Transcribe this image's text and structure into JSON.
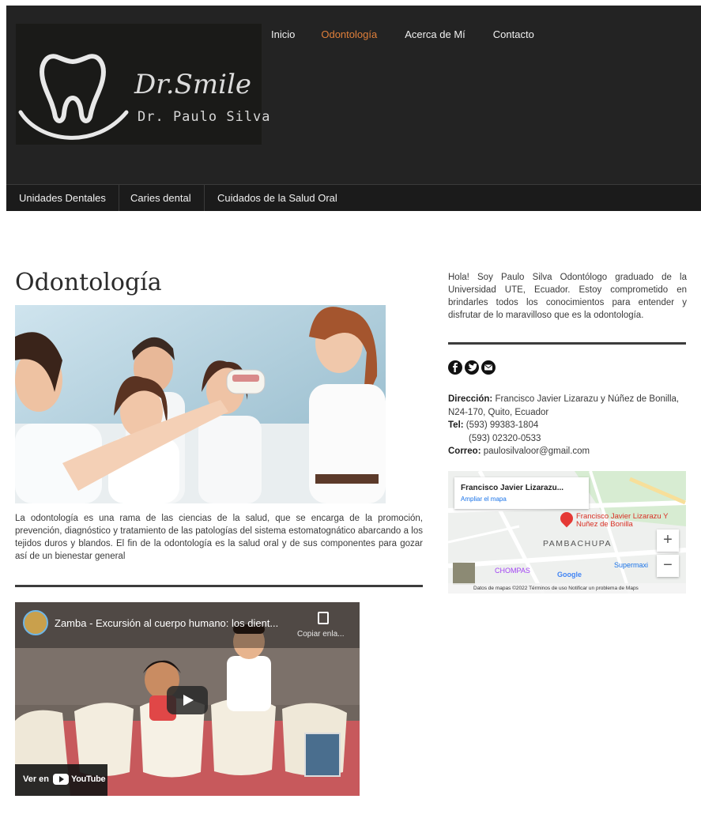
{
  "header": {
    "logo": {
      "script_text": "Dr.Smile",
      "name": "Dr. Paulo Silva"
    },
    "nav": [
      {
        "label": "Inicio",
        "active": false
      },
      {
        "label": "Odontología",
        "active": true
      },
      {
        "label": "Acerca de Mí",
        "active": false
      },
      {
        "label": "Contacto",
        "active": false
      }
    ],
    "subnav": [
      {
        "label": "Unidades Dentales"
      },
      {
        "label": "Caries dental"
      },
      {
        "label": "Cuidados de la Salud Oral"
      }
    ],
    "active_color": "#e07f3a"
  },
  "main": {
    "title": "Odontología",
    "intro": "La odontología es una rama de las ciencias de la salud, que se encarga de la promoción, prevención, diagnóstico y tratamiento de las patologías del sistema estomatognático abarcando a los tejidos duros y blandos. El fin de la odontología es la salud oral y de sus componentes para gozar así de un bienestar general",
    "video": {
      "title": "Zamba - Excursión al cuerpo humano: los dient...",
      "copy_label": "Copiar enla...",
      "watch_on": "Ver en",
      "platform": "YouTube"
    }
  },
  "sidebar": {
    "about": "Hola!  Soy Paulo Silva Odontólogo graduado de la Universidad UTE, Ecuador. Estoy comprometido en brindarles todos los conocimientos para entender y disfrutar de lo maravilloso que es la odontología.",
    "social_icons": [
      "facebook-icon",
      "twitter-icon",
      "email-icon"
    ],
    "contact": {
      "address_label": "Dirección:",
      "address": "Francisco Javier Lizarazu y Núñez de Bonilla, N24-170, Quito, Ecuador",
      "tel_label": "Tel:",
      "tel1": "(593) 99383-1804",
      "tel2": "(593) 02320-0533",
      "email_label": "Correo:",
      "email": "paulosilvaloor@gmail.com"
    },
    "map": {
      "card_title": "Francisco Javier Lizarazu...",
      "card_link": "Ampliar el mapa",
      "pin_label": "Francisco Javier Lizarazu Y Nuñez de Bonilla",
      "area": "PAMBACHUPA",
      "place1": "CHOMPAS",
      "place2": "Supermaxi",
      "google": "Google",
      "footer": "Datos de mapas ©2022   Términos de uso   Notificar un problema de Maps"
    }
  }
}
